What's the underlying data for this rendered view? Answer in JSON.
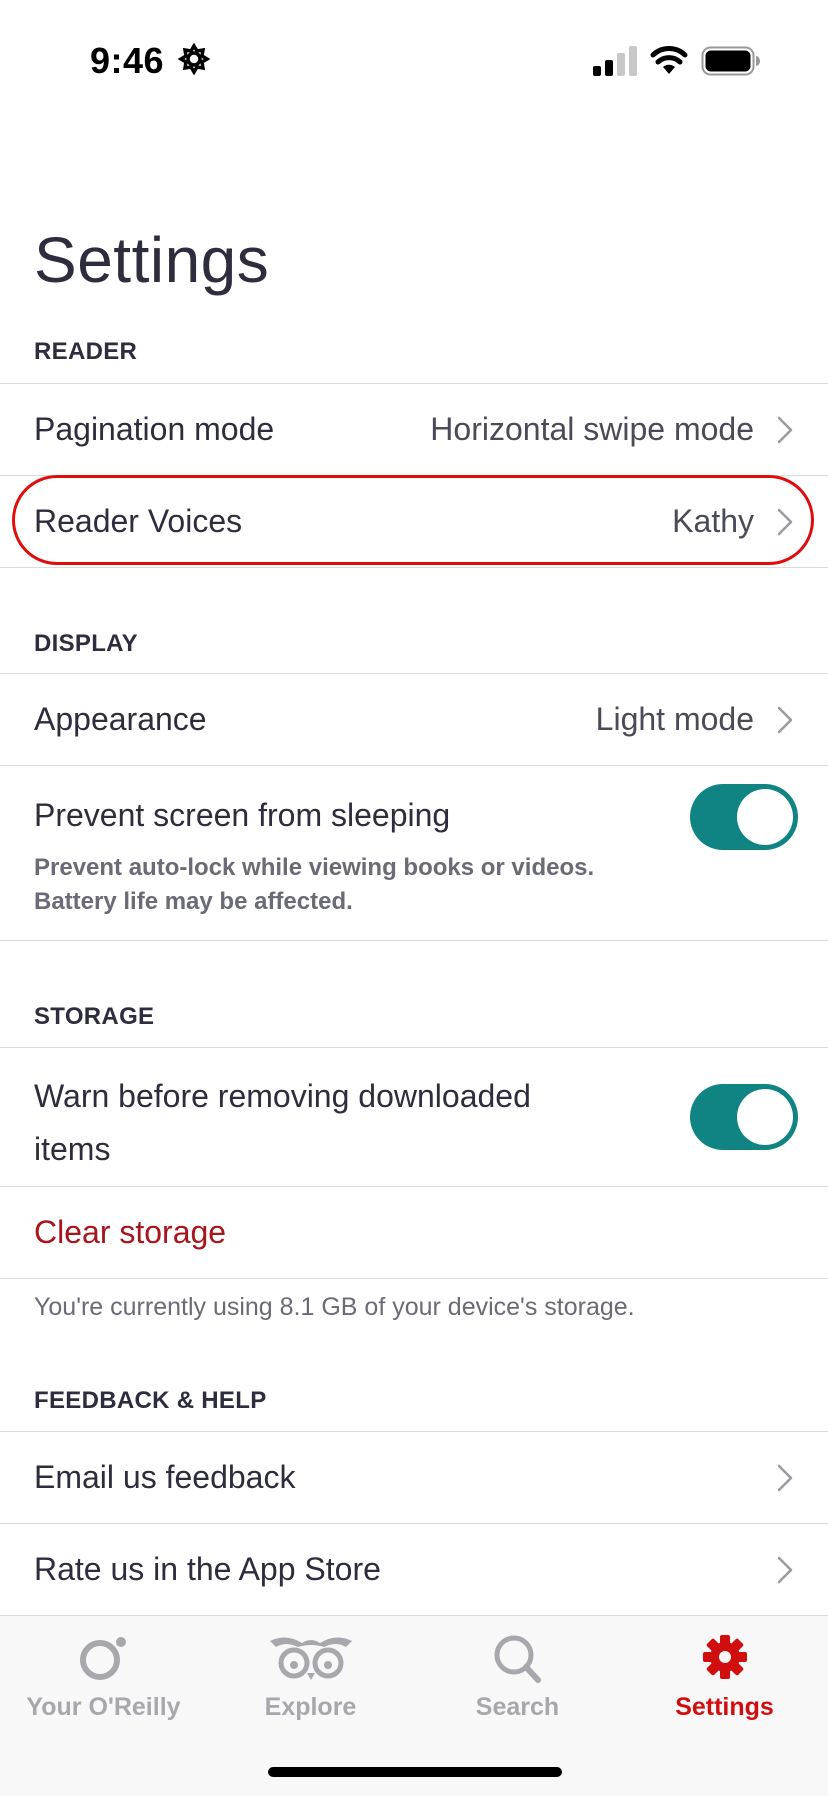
{
  "status_bar": {
    "time": "9:46"
  },
  "page": {
    "title": "Settings"
  },
  "sections": {
    "reader": {
      "header": "READER",
      "pagination_mode": {
        "label": "Pagination mode",
        "value": "Horizontal swipe mode"
      },
      "reader_voices": {
        "label": "Reader Voices",
        "value": "Kathy"
      }
    },
    "display": {
      "header": "DISPLAY",
      "appearance": {
        "label": "Appearance",
        "value": "Light mode"
      },
      "prevent_sleep": {
        "label": "Prevent screen from sleeping",
        "description": "Prevent auto-lock while viewing books or videos. Battery life may be affected.",
        "enabled": true
      }
    },
    "storage": {
      "header": "STORAGE",
      "warn_before_removing": {
        "label": "Warn before removing downloaded items",
        "enabled": true
      },
      "clear_storage": {
        "label": "Clear storage"
      },
      "usage_note": "You're currently using 8.1 GB of your device's storage."
    },
    "feedback": {
      "header": "FEEDBACK & HELP",
      "email_feedback": {
        "label": "Email us feedback"
      },
      "rate_app": {
        "label": "Rate us in the App Store"
      }
    }
  },
  "tab_bar": {
    "tabs": [
      {
        "label": "Your O'Reilly",
        "icon": "oreilly-logo-icon",
        "active": false
      },
      {
        "label": "Explore",
        "icon": "owl-icon",
        "active": false
      },
      {
        "label": "Search",
        "icon": "search-icon",
        "active": false
      },
      {
        "label": "Settings",
        "icon": "gear-icon",
        "active": true
      }
    ]
  },
  "colors": {
    "accent_red": "#d10e0e",
    "toggle_teal": "#0f8483",
    "danger_text": "#a8151c",
    "highlight_ring": "#e00d0d",
    "text_primary": "#2e2d3d"
  }
}
